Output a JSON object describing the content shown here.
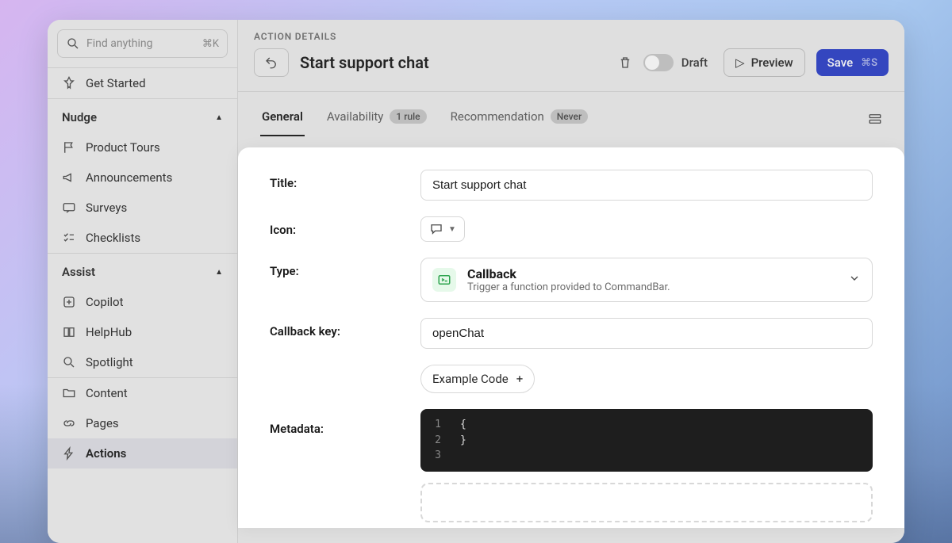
{
  "search": {
    "placeholder": "Find anything",
    "shortcut": "⌘K"
  },
  "sidebar": {
    "get_started": "Get Started",
    "sections": {
      "nudge": {
        "label": "Nudge",
        "items": [
          "Product Tours",
          "Announcements",
          "Surveys",
          "Checklists"
        ]
      },
      "assist": {
        "label": "Assist",
        "items": [
          "Copilot",
          "HelpHub",
          "Spotlight"
        ]
      }
    },
    "bottom": [
      "Content",
      "Pages",
      "Actions"
    ]
  },
  "header": {
    "crumb": "ACTION DETAILS",
    "title": "Start support chat",
    "draft": "Draft",
    "preview": "Preview",
    "save": "Save",
    "save_shortcut": "⌘S"
  },
  "tabs": {
    "general": "General",
    "availability": {
      "label": "Availability",
      "badge": "1 rule"
    },
    "recommendation": {
      "label": "Recommendation",
      "badge": "Never"
    }
  },
  "form": {
    "title": {
      "label": "Title:",
      "value": "Start support chat"
    },
    "icon": {
      "label": "Icon:"
    },
    "type": {
      "label": "Type:",
      "name": "Callback",
      "desc": "Trigger a function provided to CommandBar."
    },
    "callback_key": {
      "label": "Callback key:",
      "value": "openChat"
    },
    "example": "Example Code",
    "metadata": {
      "label": "Metadata:",
      "lines": [
        "{",
        "}",
        ""
      ]
    }
  }
}
